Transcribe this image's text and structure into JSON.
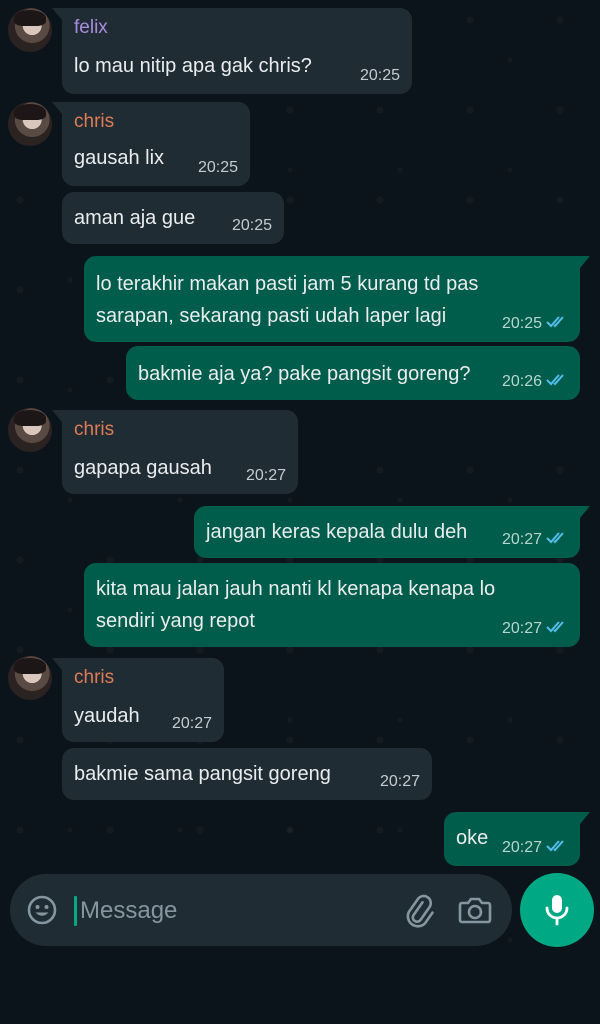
{
  "messages": [
    {
      "sender": "felix",
      "text": "lo mau nitip apa gak chris?",
      "time": "20:25"
    },
    {
      "sender": "chris",
      "text": "gausah lix",
      "time": "20:25"
    },
    {
      "text": "aman aja gue",
      "time": "20:25"
    },
    {
      "lines": [
        "lo terakhir makan pasti jam 5 kurang td pas",
        "sarapan, sekarang pasti udah laper lagi"
      ],
      "time": "20:25"
    },
    {
      "text": "bakmie aja ya? pake pangsit goreng?",
      "time": "20:26"
    },
    {
      "sender": "chris",
      "text": "gapapa gausah",
      "time": "20:27"
    },
    {
      "text": "jangan keras kepala dulu deh",
      "time": "20:27"
    },
    {
      "lines": [
        "kita mau jalan jauh nanti kl kenapa kenapa lo",
        "sendiri yang repot"
      ],
      "time": "20:27"
    },
    {
      "sender": "chris",
      "text": "yaudah",
      "time": "20:27"
    },
    {
      "text": "bakmie sama pangsit goreng",
      "time": "20:27"
    },
    {
      "text": "oke",
      "time": "20:27"
    }
  ],
  "composer": {
    "placeholder": "Message"
  },
  "icons": {
    "emoji": "emoji-icon",
    "attach": "paperclip-icon",
    "camera": "camera-icon",
    "mic": "mic-icon",
    "read_receipt": "double-check-icon"
  },
  "colors": {
    "background": "#0b141a",
    "incoming_bubble": "#202c33",
    "outgoing_bubble": "#005c4b",
    "felix_name": "#a98be0",
    "chris_name": "#e07b56",
    "read_tick": "#53bdeb",
    "accent": "#00a884"
  }
}
